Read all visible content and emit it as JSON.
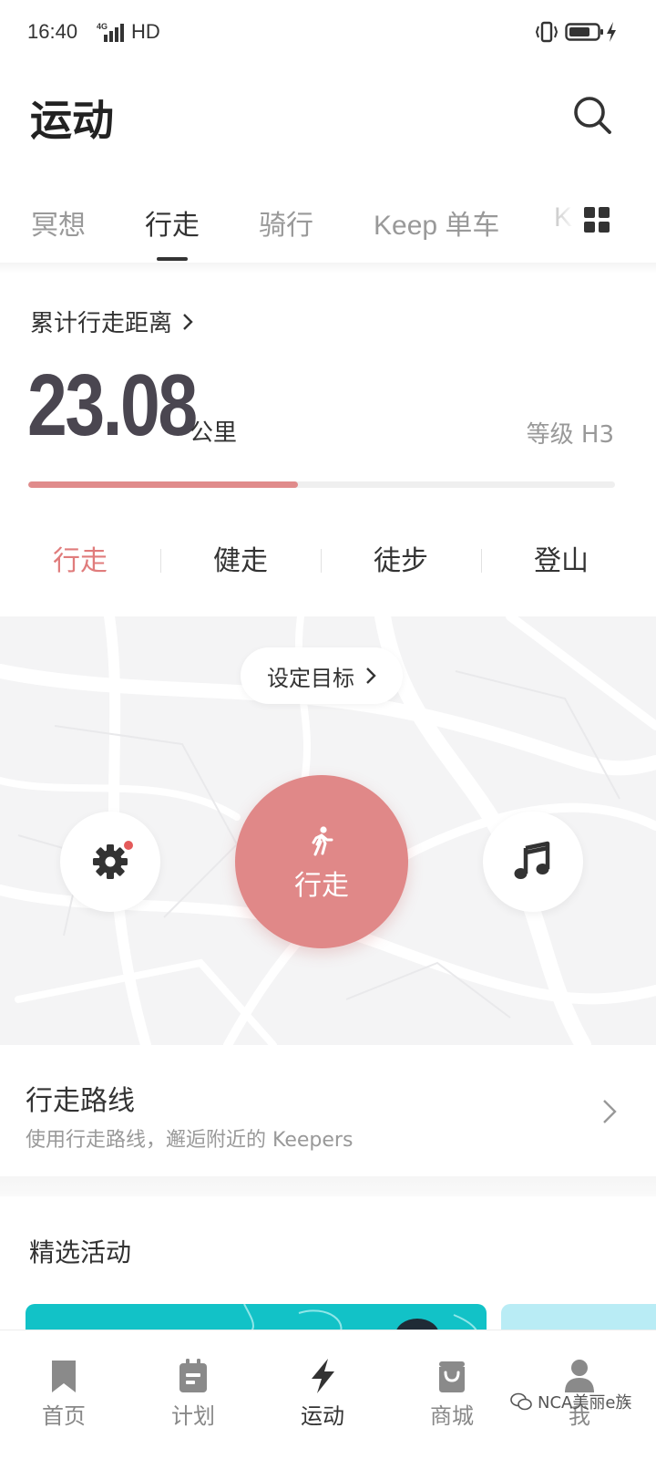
{
  "status_bar": {
    "time": "16:40",
    "network": "4G",
    "hd": "HD"
  },
  "header": {
    "title": "运动"
  },
  "tabs": [
    {
      "label": "冥想",
      "active": false
    },
    {
      "label": "行走",
      "active": true
    },
    {
      "label": "骑行",
      "active": false
    },
    {
      "label": "Keep 单车",
      "active": false
    },
    {
      "label": "K",
      "active": false
    }
  ],
  "distance": {
    "label": "累计行走距离",
    "value": "23.08",
    "unit": "公里",
    "level": "等级 H3",
    "progress": 0.46
  },
  "modes": [
    {
      "label": "行走",
      "active": true
    },
    {
      "label": "健走",
      "active": false
    },
    {
      "label": "徒步",
      "active": false
    },
    {
      "label": "登山",
      "active": false
    }
  ],
  "map": {
    "goal_label": "设定目标",
    "start_label": "行走"
  },
  "route": {
    "title": "行走路线",
    "subtitle": "使用行走路线，邂逅附近的 Keepers"
  },
  "featured": {
    "title": "精选活动"
  },
  "bottom_nav": [
    {
      "label": "首页",
      "icon": "bookmark-icon",
      "active": false
    },
    {
      "label": "计划",
      "icon": "plan-icon",
      "active": false
    },
    {
      "label": "运动",
      "icon": "lightning-icon",
      "active": true
    },
    {
      "label": "商城",
      "icon": "shopping-bag-icon",
      "active": false
    },
    {
      "label": "我",
      "icon": "person-icon",
      "active": false
    }
  ],
  "watermark": "NCA美丽e族",
  "colors": {
    "accent": "#e08888",
    "accent_text": "#e07c7c",
    "featured_teal": "#12c2c7",
    "featured_light": "#b9ecf5"
  }
}
